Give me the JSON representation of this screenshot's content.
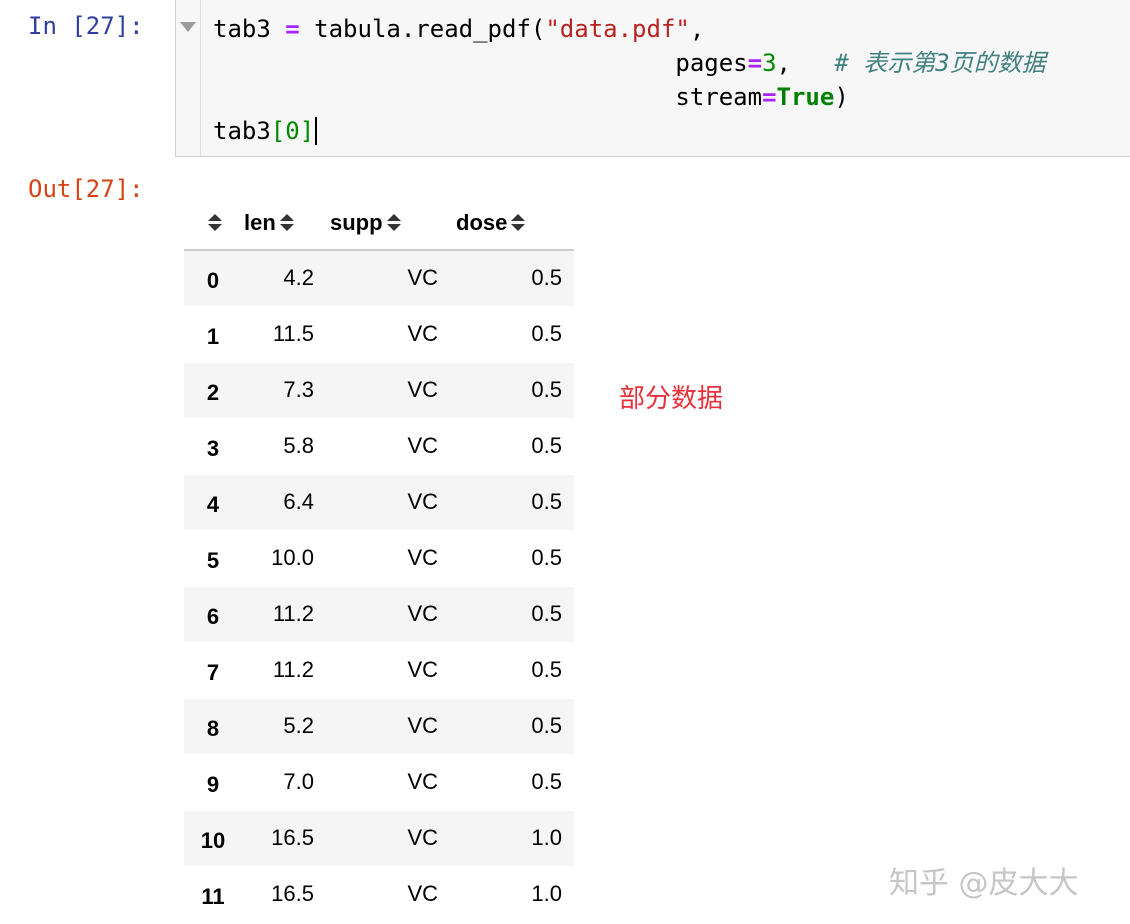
{
  "input_cell": {
    "prompt": "In [27]:",
    "code": {
      "line1_var": "tab3 ",
      "line1_op": "=",
      "line1_call": " tabula.read_pdf(",
      "line1_str": "\"data.pdf\"",
      "line1_end": ",",
      "line2_indent": "                                ",
      "line2_arg": "pages",
      "line2_op": "=",
      "line2_num": "3",
      "line2_comma": ",   ",
      "line2_comment": "# 表示第3页的数据",
      "line3_indent": "                                ",
      "line3_arg": "stream",
      "line3_op": "=",
      "line3_kw": "True",
      "line3_end": ")",
      "line4_var": "tab3",
      "line4_bracket_open": "[",
      "line4_num": "0",
      "line4_bracket_close": "]"
    }
  },
  "output_cell": {
    "prompt": "Out[27]:",
    "table": {
      "columns": [
        "",
        "len",
        "supp",
        "dose"
      ],
      "rows": [
        {
          "index": "0",
          "len": "4.2",
          "supp": "VC",
          "dose": "0.5"
        },
        {
          "index": "1",
          "len": "11.5",
          "supp": "VC",
          "dose": "0.5"
        },
        {
          "index": "2",
          "len": "7.3",
          "supp": "VC",
          "dose": "0.5"
        },
        {
          "index": "3",
          "len": "5.8",
          "supp": "VC",
          "dose": "0.5"
        },
        {
          "index": "4",
          "len": "6.4",
          "supp": "VC",
          "dose": "0.5"
        },
        {
          "index": "5",
          "len": "10.0",
          "supp": "VC",
          "dose": "0.5"
        },
        {
          "index": "6",
          "len": "11.2",
          "supp": "VC",
          "dose": "0.5"
        },
        {
          "index": "7",
          "len": "11.2",
          "supp": "VC",
          "dose": "0.5"
        },
        {
          "index": "8",
          "len": "5.2",
          "supp": "VC",
          "dose": "0.5"
        },
        {
          "index": "9",
          "len": "7.0",
          "supp": "VC",
          "dose": "0.5"
        },
        {
          "index": "10",
          "len": "16.5",
          "supp": "VC",
          "dose": "1.0"
        },
        {
          "index": "11",
          "len": "16.5",
          "supp": "VC",
          "dose": "1.0"
        }
      ]
    }
  },
  "annotation": "部分数据",
  "watermark": "知乎 @皮大大",
  "colors": {
    "in_prompt": "#303f9f",
    "out_prompt": "#d84315",
    "annotation": "#e8303a",
    "string": "#ba2121",
    "operator": "#aa22ff",
    "keyword": "#008000",
    "comment": "#408080"
  },
  "icons": {
    "collapse": "chevron-down-icon",
    "sort": "sort-icon"
  }
}
